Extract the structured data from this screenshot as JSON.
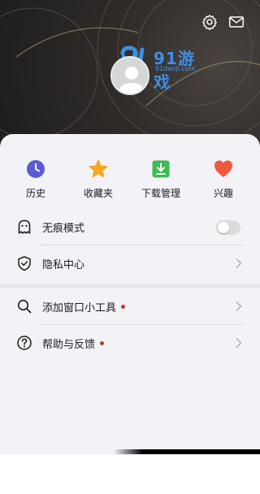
{
  "header": {
    "settings_icon": "gear-icon",
    "mail_icon": "mail-icon",
    "avatar_icon": "user-avatar-icon",
    "watermark": {
      "main": "91游戏",
      "sub": "91danji.com"
    }
  },
  "quick_actions": [
    {
      "label": "历史",
      "icon": "clock-icon",
      "color": "#5b5bd6"
    },
    {
      "label": "收藏夹",
      "icon": "star-icon",
      "color": "#f5a623"
    },
    {
      "label": "下载管理",
      "icon": "download-icon",
      "color": "#3dba52"
    },
    {
      "label": "兴趣",
      "icon": "heart-icon",
      "color": "#ef5a3c"
    }
  ],
  "menu": {
    "incognito": {
      "label": "无痕模式",
      "icon": "ghost-icon",
      "toggle_on": false
    },
    "privacy": {
      "label": "隐私中心",
      "icon": "shield-check-icon"
    },
    "widget": {
      "label": "添加窗口小工具",
      "icon": "search-icon",
      "badge_color": "#c0392b"
    },
    "help": {
      "label": "帮助与反馈",
      "icon": "question-circle-icon",
      "badge_color": "#c0392b"
    }
  }
}
